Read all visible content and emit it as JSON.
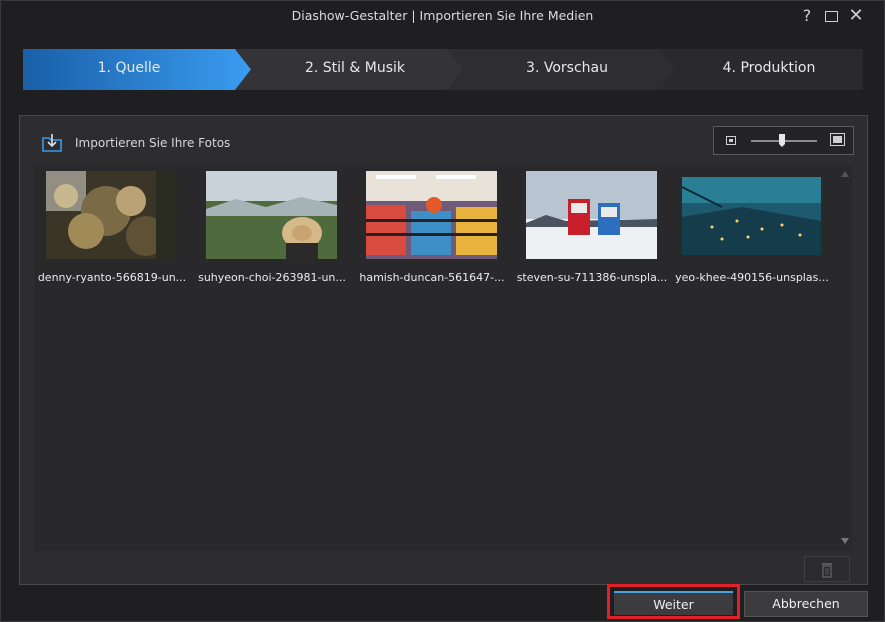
{
  "window": {
    "title": "Diashow-Gestalter | Importieren Sie Ihre Medien",
    "help": "?",
    "close": "✕"
  },
  "steps": [
    {
      "label": "1. Quelle",
      "active": true
    },
    {
      "label": "2. Stil & Musik",
      "active": false
    },
    {
      "label": "3. Vorschau",
      "active": false
    },
    {
      "label": "4. Produktion",
      "active": false
    }
  ],
  "import": {
    "label": "Importieren Sie Ihre Fotos"
  },
  "photos": [
    {
      "caption": "denny-ryanto-566819-un..."
    },
    {
      "caption": "suhyeon-choi-263981-un..."
    },
    {
      "caption": "hamish-duncan-561647-..."
    },
    {
      "caption": "steven-su-711386-unspla..."
    },
    {
      "caption": "yeo-khee-490156-unsplas..."
    }
  ],
  "buttons": {
    "next": "Weiter",
    "cancel": "Abbrechen"
  },
  "colors": {
    "accent": "#2f8fe0",
    "highlight": "#e3202a"
  }
}
